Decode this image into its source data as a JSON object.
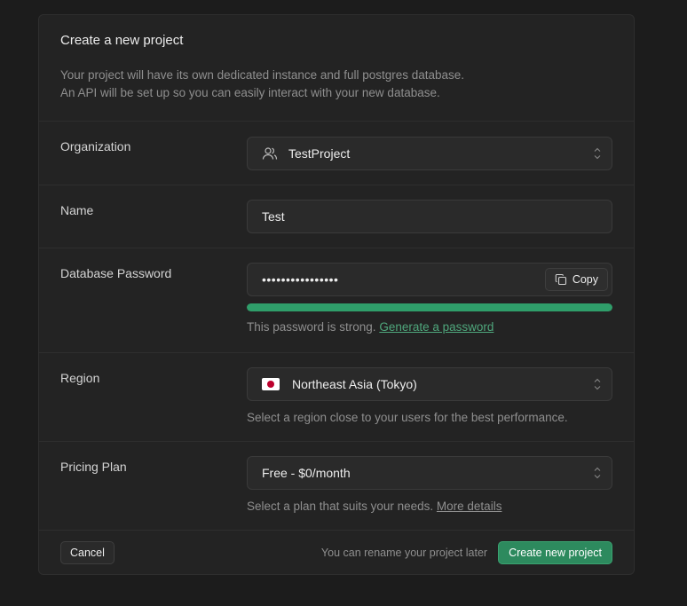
{
  "dialog": {
    "title": "Create a new project",
    "description_line1": "Your project will have its own dedicated instance and full postgres database.",
    "description_line2": "An API will be set up so you can easily interact with your new database."
  },
  "organization": {
    "label": "Organization",
    "value": "TestProject",
    "icon": "users-icon"
  },
  "name": {
    "label": "Name",
    "value": "Test"
  },
  "password": {
    "label": "Database Password",
    "value": "••••••••••••••••",
    "copy_label": "Copy",
    "strength_text": "This password is strong.",
    "generate_link": "Generate a password",
    "strength_fraction": 1.0,
    "strength_color": "#2f9e6a"
  },
  "region": {
    "label": "Region",
    "value": "Northeast Asia (Tokyo)",
    "hint": "Select a region close to your users for the best performance."
  },
  "plan": {
    "label": "Pricing Plan",
    "value": "Free - $0/month",
    "hint": "Select a plan that suits your needs.",
    "hint_link": "More details"
  },
  "footer": {
    "cancel_label": "Cancel",
    "note": "You can rename your project later",
    "create_label": "Create new project"
  }
}
